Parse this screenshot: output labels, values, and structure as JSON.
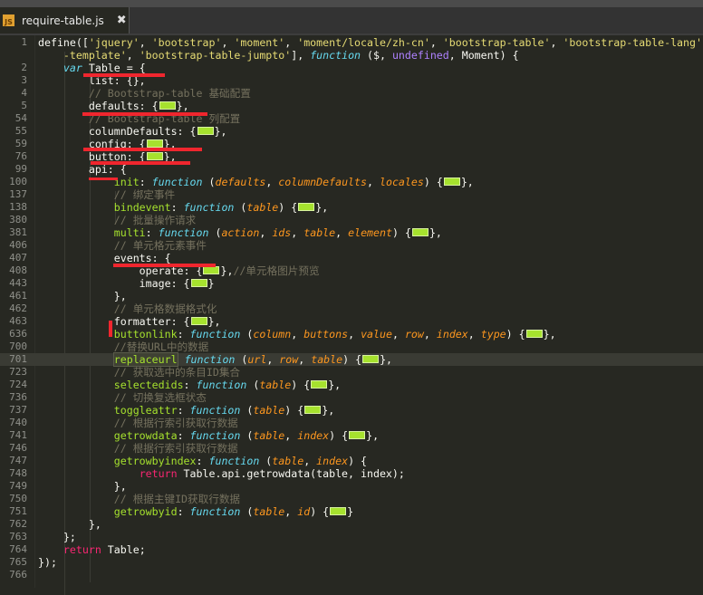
{
  "tab": {
    "label": "require-table.js",
    "icon": "js-file-icon",
    "close_icon": "close-icon"
  },
  "colors": {
    "background": "#272822",
    "string": "#e6db74",
    "keyword": "#66d9ef",
    "comment": "#75715e",
    "param": "#fd971f",
    "function_name": "#a6e22e",
    "annotation": "#f0262e"
  },
  "current_line": "701",
  "lines": [
    {
      "n": "1",
      "t": [
        [
          "p",
          "define(["
        ],
        [
          "s",
          "'jquery'"
        ],
        [
          "p",
          ", "
        ],
        [
          "s",
          "'bootstrap'"
        ],
        [
          "p",
          ", "
        ],
        [
          "s",
          "'moment'"
        ],
        [
          "p",
          ", "
        ],
        [
          "s",
          "'moment/locale/zh-cn'"
        ],
        [
          "p",
          ", "
        ],
        [
          "s",
          "'bootstrap-table'"
        ],
        [
          "p",
          ", "
        ],
        [
          "s",
          "'bootstrap-table-lang'"
        ]
      ]
    },
    {
      "n": "",
      "t": [
        [
          "p",
          "    "
        ],
        [
          "s",
          "-template'"
        ],
        [
          "p",
          ", "
        ],
        [
          "s",
          "'bootstrap-table-jumpto'"
        ],
        [
          "p",
          "], "
        ],
        [
          "k",
          "function"
        ],
        [
          "p",
          " ($, "
        ],
        [
          "u",
          "undefined"
        ],
        [
          "p",
          ", Moment) {"
        ]
      ]
    },
    {
      "n": "2",
      "t": [
        [
          "p",
          "    "
        ],
        [
          "k",
          "var"
        ],
        [
          "p",
          " Table = {"
        ]
      ]
    },
    {
      "n": "3",
      "t": [
        [
          "p",
          "        list: {},"
        ]
      ]
    },
    {
      "n": "4",
      "t": [
        [
          "p",
          "        "
        ],
        [
          "c",
          "// Bootstrap-table 基础配置"
        ]
      ]
    },
    {
      "n": "5",
      "t": [
        [
          "p",
          "        defaults: {"
        ],
        [
          "fold",
          ""
        ],
        [
          "p",
          "},"
        ]
      ]
    },
    {
      "n": "54",
      "t": [
        [
          "p",
          "        "
        ],
        [
          "c",
          "// Bootstrap-table 列配置"
        ]
      ]
    },
    {
      "n": "55",
      "t": [
        [
          "p",
          "        columnDefaults: {"
        ],
        [
          "fold",
          ""
        ],
        [
          "p",
          "},"
        ]
      ]
    },
    {
      "n": "59",
      "t": [
        [
          "p",
          "        config: {"
        ],
        [
          "fold",
          ""
        ],
        [
          "p",
          "},"
        ]
      ]
    },
    {
      "n": "76",
      "t": [
        [
          "p",
          "        button: {"
        ],
        [
          "fold",
          ""
        ],
        [
          "p",
          "},"
        ]
      ]
    },
    {
      "n": "99",
      "t": [
        [
          "p",
          "        api: {"
        ]
      ]
    },
    {
      "n": "100",
      "t": [
        [
          "p",
          "            "
        ],
        [
          "f",
          "init"
        ],
        [
          "p",
          ": "
        ],
        [
          "k",
          "function"
        ],
        [
          "p",
          " ("
        ],
        [
          "a",
          "defaults"
        ],
        [
          "p",
          ", "
        ],
        [
          "a",
          "columnDefaults"
        ],
        [
          "p",
          ", "
        ],
        [
          "a",
          "locales"
        ],
        [
          "p",
          ") {"
        ],
        [
          "fold",
          ""
        ],
        [
          "p",
          "},"
        ]
      ]
    },
    {
      "n": "137",
      "t": [
        [
          "p",
          "            "
        ],
        [
          "c",
          "// 绑定事件"
        ]
      ]
    },
    {
      "n": "138",
      "t": [
        [
          "p",
          "            "
        ],
        [
          "f",
          "bindevent"
        ],
        [
          "p",
          ": "
        ],
        [
          "k",
          "function"
        ],
        [
          "p",
          " ("
        ],
        [
          "a",
          "table"
        ],
        [
          "p",
          ") {"
        ],
        [
          "fold",
          ""
        ],
        [
          "p",
          "},"
        ]
      ]
    },
    {
      "n": "380",
      "t": [
        [
          "p",
          "            "
        ],
        [
          "c",
          "// 批量操作请求"
        ]
      ]
    },
    {
      "n": "381",
      "t": [
        [
          "p",
          "            "
        ],
        [
          "f",
          "multi"
        ],
        [
          "p",
          ": "
        ],
        [
          "k",
          "function"
        ],
        [
          "p",
          " ("
        ],
        [
          "a",
          "action"
        ],
        [
          "p",
          ", "
        ],
        [
          "a",
          "ids"
        ],
        [
          "p",
          ", "
        ],
        [
          "a",
          "table"
        ],
        [
          "p",
          ", "
        ],
        [
          "a",
          "element"
        ],
        [
          "p",
          ") {"
        ],
        [
          "fold",
          ""
        ],
        [
          "p",
          "},"
        ]
      ]
    },
    {
      "n": "406",
      "t": [
        [
          "p",
          "            "
        ],
        [
          "c",
          "// 单元格元素事件"
        ]
      ]
    },
    {
      "n": "407",
      "t": [
        [
          "p",
          "            events: {"
        ]
      ]
    },
    {
      "n": "408",
      "t": [
        [
          "p",
          "                operate: {"
        ],
        [
          "fold",
          ""
        ],
        [
          "p",
          "},"
        ],
        [
          "c",
          "//单元格图片预览"
        ]
      ]
    },
    {
      "n": "443",
      "t": [
        [
          "p",
          "                image: {"
        ],
        [
          "fold",
          ""
        ],
        [
          "p",
          "}"
        ]
      ]
    },
    {
      "n": "461",
      "t": [
        [
          "p",
          "            },"
        ]
      ]
    },
    {
      "n": "462",
      "t": [
        [
          "p",
          "            "
        ],
        [
          "c",
          "// 单元格数据格式化"
        ]
      ]
    },
    {
      "n": "463",
      "t": [
        [
          "p",
          "            formatter: {"
        ],
        [
          "fold",
          ""
        ],
        [
          "p",
          "},"
        ]
      ]
    },
    {
      "n": "636",
      "t": [
        [
          "p",
          "            "
        ],
        [
          "f",
          "buttonlink"
        ],
        [
          "p",
          ": "
        ],
        [
          "k",
          "function"
        ],
        [
          "p",
          " ("
        ],
        [
          "a",
          "column"
        ],
        [
          "p",
          ", "
        ],
        [
          "a",
          "buttons"
        ],
        [
          "p",
          ", "
        ],
        [
          "a",
          "value"
        ],
        [
          "p",
          ", "
        ],
        [
          "a",
          "row"
        ],
        [
          "p",
          ", "
        ],
        [
          "a",
          "index"
        ],
        [
          "p",
          ", "
        ],
        [
          "a",
          "type"
        ],
        [
          "p",
          ") {"
        ],
        [
          "fold",
          ""
        ],
        [
          "p",
          "},"
        ]
      ]
    },
    {
      "n": "700",
      "t": [
        [
          "p",
          "            "
        ],
        [
          "c",
          "//替换URL中的数据"
        ]
      ]
    },
    {
      "n": "701",
      "t": [
        [
          "p",
          "            "
        ],
        [
          "sel",
          "replaceurl"
        ],
        [
          "cursor",
          ""
        ],
        [
          "p",
          " "
        ],
        [
          "k",
          "function"
        ],
        [
          "p",
          " ("
        ],
        [
          "a",
          "url"
        ],
        [
          "p",
          ", "
        ],
        [
          "a",
          "row"
        ],
        [
          "p",
          ", "
        ],
        [
          "a",
          "table"
        ],
        [
          "p",
          ") {"
        ],
        [
          "fold",
          ""
        ],
        [
          "p",
          "},"
        ]
      ]
    },
    {
      "n": "723",
      "t": [
        [
          "p",
          "            "
        ],
        [
          "c",
          "// 获取选中的条目ID集合"
        ]
      ]
    },
    {
      "n": "724",
      "t": [
        [
          "p",
          "            "
        ],
        [
          "f",
          "selectedids"
        ],
        [
          "p",
          ": "
        ],
        [
          "k",
          "function"
        ],
        [
          "p",
          " ("
        ],
        [
          "a",
          "table"
        ],
        [
          "p",
          ") {"
        ],
        [
          "fold",
          ""
        ],
        [
          "p",
          "},"
        ]
      ]
    },
    {
      "n": "736",
      "t": [
        [
          "p",
          "            "
        ],
        [
          "c",
          "// 切换复选框状态"
        ]
      ]
    },
    {
      "n": "737",
      "t": [
        [
          "p",
          "            "
        ],
        [
          "f",
          "toggleattr"
        ],
        [
          "p",
          ": "
        ],
        [
          "k",
          "function"
        ],
        [
          "p",
          " ("
        ],
        [
          "a",
          "table"
        ],
        [
          "p",
          ") {"
        ],
        [
          "fold",
          ""
        ],
        [
          "p",
          "},"
        ]
      ]
    },
    {
      "n": "740",
      "t": [
        [
          "p",
          "            "
        ],
        [
          "c",
          "// 根据行索引获取行数据"
        ]
      ]
    },
    {
      "n": "741",
      "t": [
        [
          "p",
          "            "
        ],
        [
          "f",
          "getrowdata"
        ],
        [
          "p",
          ": "
        ],
        [
          "k",
          "function"
        ],
        [
          "p",
          " ("
        ],
        [
          "a",
          "table"
        ],
        [
          "p",
          ", "
        ],
        [
          "a",
          "index"
        ],
        [
          "p",
          ") {"
        ],
        [
          "fold",
          ""
        ],
        [
          "p",
          "},"
        ]
      ]
    },
    {
      "n": "746",
      "t": [
        [
          "p",
          "            "
        ],
        [
          "c",
          "// 根据行索引获取行数据"
        ]
      ]
    },
    {
      "n": "747",
      "t": [
        [
          "p",
          "            "
        ],
        [
          "f",
          "getrowbyindex"
        ],
        [
          "p",
          ": "
        ],
        [
          "k",
          "function"
        ],
        [
          "p",
          " ("
        ],
        [
          "a",
          "table"
        ],
        [
          "p",
          ", "
        ],
        [
          "a",
          "index"
        ],
        [
          "p",
          ") {"
        ]
      ]
    },
    {
      "n": "748",
      "t": [
        [
          "p",
          "                "
        ],
        [
          "r",
          "return"
        ],
        [
          "p",
          " Table.api.getrowdata(table, index);"
        ]
      ]
    },
    {
      "n": "749",
      "t": [
        [
          "p",
          "            },"
        ]
      ]
    },
    {
      "n": "750",
      "t": [
        [
          "p",
          "            "
        ],
        [
          "c",
          "// 根据主键ID获取行数据"
        ]
      ]
    },
    {
      "n": "751",
      "t": [
        [
          "p",
          "            "
        ],
        [
          "f",
          "getrowbyid"
        ],
        [
          "p",
          ": "
        ],
        [
          "k",
          "function"
        ],
        [
          "p",
          " ("
        ],
        [
          "a",
          "table"
        ],
        [
          "p",
          ", "
        ],
        [
          "a",
          "id"
        ],
        [
          "p",
          ") {"
        ],
        [
          "fold",
          ""
        ],
        [
          "p",
          "}"
        ]
      ]
    },
    {
      "n": "762",
      "t": [
        [
          "p",
          "        },"
        ]
      ]
    },
    {
      "n": "763",
      "t": [
        [
          "p",
          "    };"
        ]
      ]
    },
    {
      "n": "764",
      "t": [
        [
          "p",
          "    "
        ],
        [
          "r",
          "return"
        ],
        [
          "p",
          " Table;"
        ]
      ]
    },
    {
      "n": "765",
      "t": [
        [
          "p",
          "});"
        ]
      ]
    },
    {
      "n": "766",
      "t": []
    }
  ]
}
